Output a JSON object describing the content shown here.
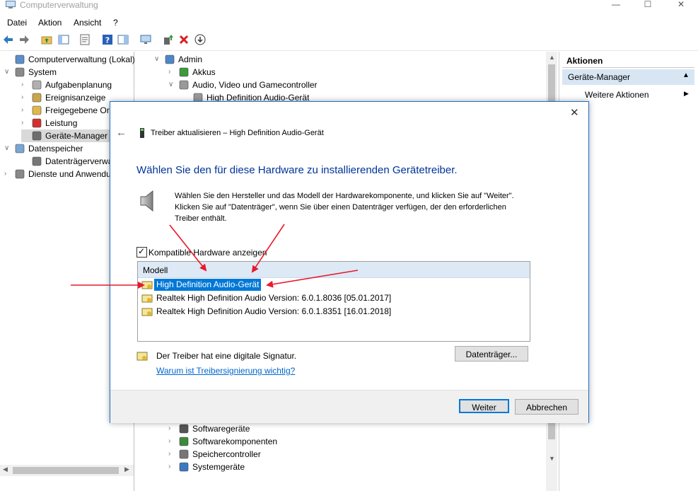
{
  "window": {
    "title": "Computerverwaltung",
    "controls": [
      "minimize-icon",
      "maximize-icon",
      "close-icon"
    ]
  },
  "menu": [
    "Datei",
    "Aktion",
    "Ansicht",
    "?"
  ],
  "toolbar": [
    "back-icon",
    "forward-icon",
    "folder-up-icon",
    "show-hide-tree-icon",
    "properties-icon",
    "help-icon",
    "help-pane-icon",
    "monitor-icon",
    "update-driver-icon",
    "uninstall-icon",
    "down-arrow-icon"
  ],
  "left_tree": [
    {
      "label": "Computerverwaltung (Lokal)",
      "level": 0,
      "chevron": "",
      "icon": "computer-management-icon"
    },
    {
      "label": "System",
      "level": 0,
      "chevron": "v",
      "icon": "system-tools-icon"
    },
    {
      "label": "Aufgabenplanung",
      "level": 1,
      "chevron": ">",
      "icon": "clock-icon"
    },
    {
      "label": "Ereignisanzeige",
      "level": 1,
      "chevron": ">",
      "icon": "event-viewer-icon"
    },
    {
      "label": "Freigegebene Ordner",
      "level": 1,
      "chevron": ">",
      "icon": "shared-folders-icon"
    },
    {
      "label": "Leistung",
      "level": 1,
      "chevron": ">",
      "icon": "performance-icon"
    },
    {
      "label": "Geräte-Manager",
      "level": 1,
      "chevron": "",
      "icon": "device-manager-icon",
      "selected": true
    },
    {
      "label": "Datenspeicher",
      "level": 0,
      "chevron": "v",
      "icon": "storage-icon"
    },
    {
      "label": "Datenträgerverwaltung",
      "level": 1,
      "chevron": "",
      "icon": "disk-management-icon"
    },
    {
      "label": "Dienste und Anwendungen",
      "level": 0,
      "chevron": ">",
      "icon": "services-icon"
    }
  ],
  "device_tree_top": [
    {
      "label": "Admin",
      "level": 0,
      "chevron": "v",
      "icon": "computer-icon"
    },
    {
      "label": "Akkus",
      "level": 1,
      "chevron": ">",
      "icon": "battery-icon"
    },
    {
      "label": "Audio, Video und Gamecontroller",
      "level": 1,
      "chevron": "v",
      "icon": "speaker-icon"
    },
    {
      "label": "High Definition Audio-Gerät",
      "level": 2,
      "chevron": "",
      "icon": "speaker-icon"
    }
  ],
  "device_tree_bottom": [
    {
      "label": "Softwaregeräte",
      "level": 1,
      "chevron": ">",
      "icon": "software-device-icon"
    },
    {
      "label": "Softwarekomponenten",
      "level": 1,
      "chevron": ">",
      "icon": "software-component-icon"
    },
    {
      "label": "Speichercontroller",
      "level": 1,
      "chevron": ">",
      "icon": "storage-controller-icon"
    },
    {
      "label": "Systemgeräte",
      "level": 1,
      "chevron": ">",
      "icon": "system-device-icon"
    }
  ],
  "actions": {
    "header": "Aktionen",
    "section": "Geräte-Manager",
    "more": "Weitere Aktionen"
  },
  "dialog": {
    "title": "Treiber aktualisieren – High Definition Audio-Gerät",
    "heading": "Wählen Sie den für diese Hardware zu installierenden Gerätetreiber.",
    "description": "Wählen Sie den Hersteller und das Modell der Hardwarekomponente, und klicken Sie auf \"Weiter\". Klicken Sie auf \"Datenträger\", wenn Sie über einen Datenträger verfügen, der den erforderlichen Treiber enthält.",
    "checkbox_label": "Kompatible Hardware anzeigen",
    "checkbox_checked": true,
    "list_header": "Modell",
    "models": [
      {
        "label": "High Definition Audio-Gerät",
        "selected": true
      },
      {
        "label": "Realtek High Definition Audio Version: 6.0.1.8036 [05.01.2017]",
        "selected": false
      },
      {
        "label": "Realtek High Definition Audio Version: 6.0.1.8351 [16.01.2018]",
        "selected": false
      }
    ],
    "signature_text": "Der Treiber hat eine digitale Signatur.",
    "signature_link": "Warum ist Treibersignierung wichtig?",
    "disk_button": "Datenträger...",
    "next_button": "Weiter",
    "cancel_button": "Abbrechen"
  },
  "colors": {
    "selection": "#0078d7",
    "heading": "#003399",
    "link": "#0066cc",
    "annotation_arrow": "#e8192c"
  }
}
